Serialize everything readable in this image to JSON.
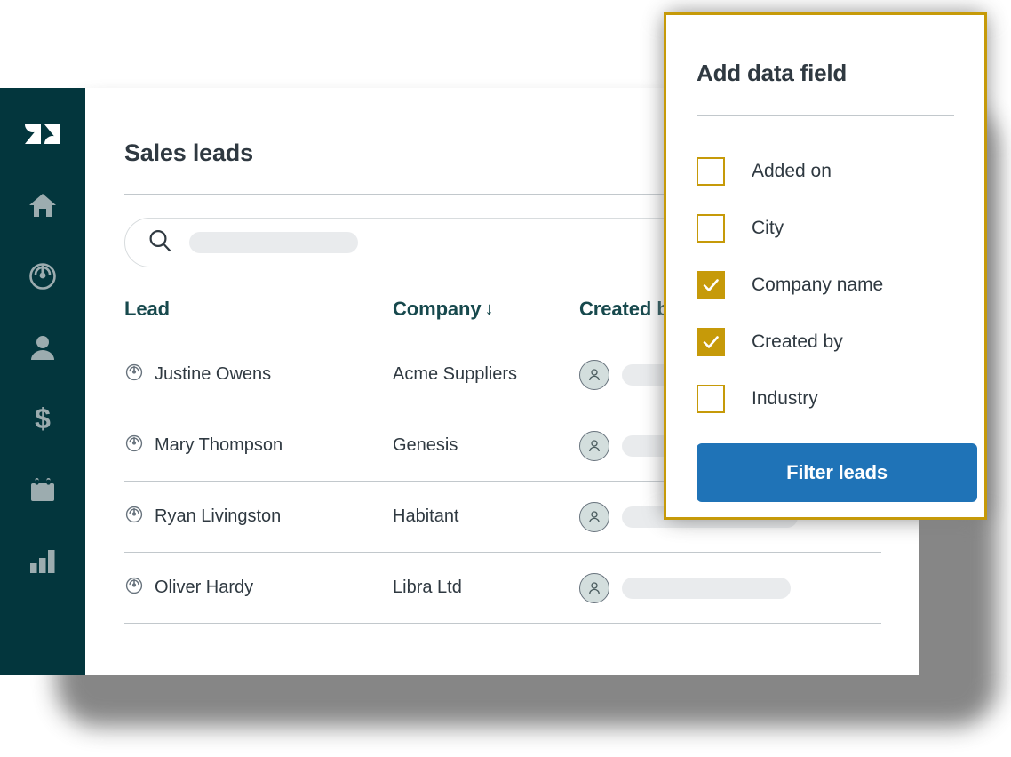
{
  "app": {
    "brand": "zendesk",
    "accent_gold": "#C69A09",
    "accent_blue": "#1F73B7",
    "nav_background": "#03363D"
  },
  "sidebar": {
    "logo_name": "zendesk-logo",
    "items": [
      {
        "icon": "home-icon",
        "label": "Home"
      },
      {
        "icon": "prospect-icon",
        "label": "Prospect"
      },
      {
        "icon": "contacts-icon",
        "label": "Contacts"
      },
      {
        "icon": "deals-icon",
        "label": "Deals"
      },
      {
        "icon": "calendar-icon",
        "label": "Calendar"
      },
      {
        "icon": "reports-icon",
        "label": "Reports"
      }
    ]
  },
  "page": {
    "title": "Sales leads"
  },
  "search": {
    "icon": "search-icon",
    "value": "",
    "placeholder": ""
  },
  "table": {
    "columns": [
      {
        "key": "lead",
        "label": "Lead",
        "sorted": false
      },
      {
        "key": "company",
        "label": "Company",
        "sorted": true,
        "sort_glyph": "↓"
      },
      {
        "key": "created",
        "label": "Created by",
        "sorted": false
      }
    ],
    "rows": [
      {
        "lead": "Justine Owens",
        "company": "Acme Suppliers",
        "created_by_avatar": "person-avatar",
        "created_by_skeleton_width": 150
      },
      {
        "lead": "Mary Thompson",
        "company": "Genesis",
        "created_by_avatar": "person-avatar",
        "created_by_skeleton_width": 150
      },
      {
        "lead": "Ryan Livingston",
        "company": "Habitant",
        "created_by_avatar": "person-avatar",
        "created_by_skeleton_width": 198
      },
      {
        "lead": "Oliver Hardy",
        "company": "Libra Ltd",
        "created_by_avatar": "person-avatar",
        "created_by_skeleton_width": 190
      }
    ]
  },
  "panel": {
    "title": "Add data field",
    "options": [
      {
        "label": "Added on",
        "checked": false
      },
      {
        "label": "City",
        "checked": false
      },
      {
        "label": "Company name",
        "checked": true
      },
      {
        "label": "Created by",
        "checked": true
      },
      {
        "label": "Industry",
        "checked": false
      }
    ],
    "submit_label": "Filter leads"
  }
}
